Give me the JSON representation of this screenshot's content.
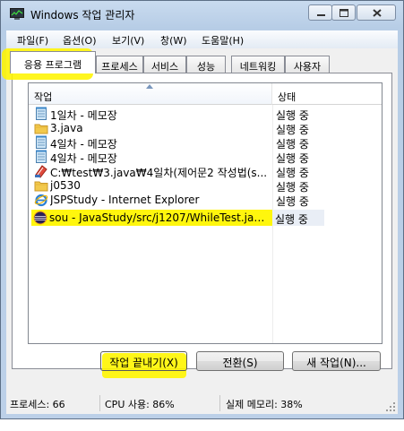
{
  "window": {
    "title": "Windows 작업 관리자"
  },
  "menu": [
    "파일(F)",
    "옵션(O)",
    "보기(V)",
    "창(W)",
    "도움말(H)"
  ],
  "tabs": [
    {
      "label": "응용 프로그램",
      "active": true
    },
    {
      "label": "프로세스",
      "active": false
    },
    {
      "label": "서비스",
      "active": false
    },
    {
      "label": "성능",
      "active": false
    },
    {
      "label": "네트워킹",
      "active": false
    },
    {
      "label": "사용자",
      "active": false
    }
  ],
  "columns": {
    "task": "작업",
    "status": "상태"
  },
  "tasks": [
    {
      "name": "1일차 - 메모장",
      "status": "실행 중",
      "icon": "notepad-icon"
    },
    {
      "name": "3.java",
      "status": "실행 중",
      "icon": "folder-icon"
    },
    {
      "name": "4일차 - 메모장",
      "status": "실행 중",
      "icon": "notepad-icon"
    },
    {
      "name": "4일차 - 메모장",
      "status": "실행 중",
      "icon": "notepad-icon"
    },
    {
      "name": "C:₩test₩3.java₩4일차(제어문2 작성법(s...",
      "status": "실행 중",
      "icon": "hwp-document-icon"
    },
    {
      "name": "j0530",
      "status": "실행 중",
      "icon": "folder-icon"
    },
    {
      "name": "JSPStudy - Internet Explorer",
      "status": "실행 중",
      "icon": "internet-explorer-icon"
    },
    {
      "name": "sou - JavaStudy/src/j1207/WhileTest.jav...",
      "status": "실행 중",
      "icon": "eclipse-icon",
      "selected": true
    }
  ],
  "buttons": {
    "end_task": "작업 끝내기(X)",
    "switch_to": "전환(S)",
    "new_task": "새 작업(N)..."
  },
  "status_bar": {
    "processes": "프로세스: 66",
    "cpu": "CPU 사용: 86%",
    "memory": "실제 메모리: 38%"
  },
  "highlight_color": "#fff500",
  "selection_color": "#d7e6fa"
}
